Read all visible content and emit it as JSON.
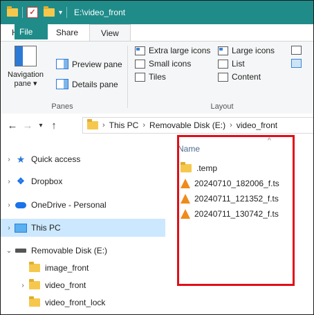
{
  "window": {
    "title": "E:\\video_front"
  },
  "ribbon_tabs": [
    "File",
    "Home",
    "Share",
    "View"
  ],
  "ribbon": {
    "panes": {
      "navigation_pane_line1": "Navigation",
      "navigation_pane_line2": "pane ▾",
      "preview_pane": "Preview pane",
      "details_pane": "Details pane",
      "group_label": "Panes"
    },
    "layout": {
      "extra_large_icons": "Extra large icons",
      "large_icons": "Large icons",
      "small_icons": "Small icons",
      "list": "List",
      "tiles": "Tiles",
      "content": "Content",
      "group_label": "Layout"
    }
  },
  "address": {
    "crumbs": [
      "This PC",
      "Removable Disk (E:)",
      "video_front"
    ]
  },
  "nav_pane": {
    "items": [
      {
        "label": "Quick access",
        "icon": "star-icon"
      },
      {
        "label": "Dropbox",
        "icon": "dropbox-icon"
      },
      {
        "label": "OneDrive - Personal",
        "icon": "cloud-icon"
      },
      {
        "label": "This PC",
        "icon": "monitor-icon",
        "selected": true
      },
      {
        "label": "Removable Disk (E:)",
        "icon": "drive-icon",
        "expanded": true
      },
      {
        "label": "image_front",
        "icon": "folder-icon"
      },
      {
        "label": "video_front",
        "icon": "folder-icon"
      },
      {
        "label": "video_front_lock",
        "icon": "folder-icon"
      }
    ]
  },
  "content": {
    "column_header": "Name",
    "files": [
      {
        "name": ".temp",
        "type": "folder"
      },
      {
        "name": "20240710_182006_f.ts",
        "type": "vlc-media"
      },
      {
        "name": "20240711_121352_f.ts",
        "type": "vlc-media"
      },
      {
        "name": "20240711_130742_f.ts",
        "type": "vlc-media"
      }
    ]
  },
  "colors": {
    "accent": "#1f8c8a",
    "selection": "#cce8ff",
    "highlight_border": "#e10e18",
    "folder": "#f5c84d",
    "vlc": "#f08a1c"
  }
}
